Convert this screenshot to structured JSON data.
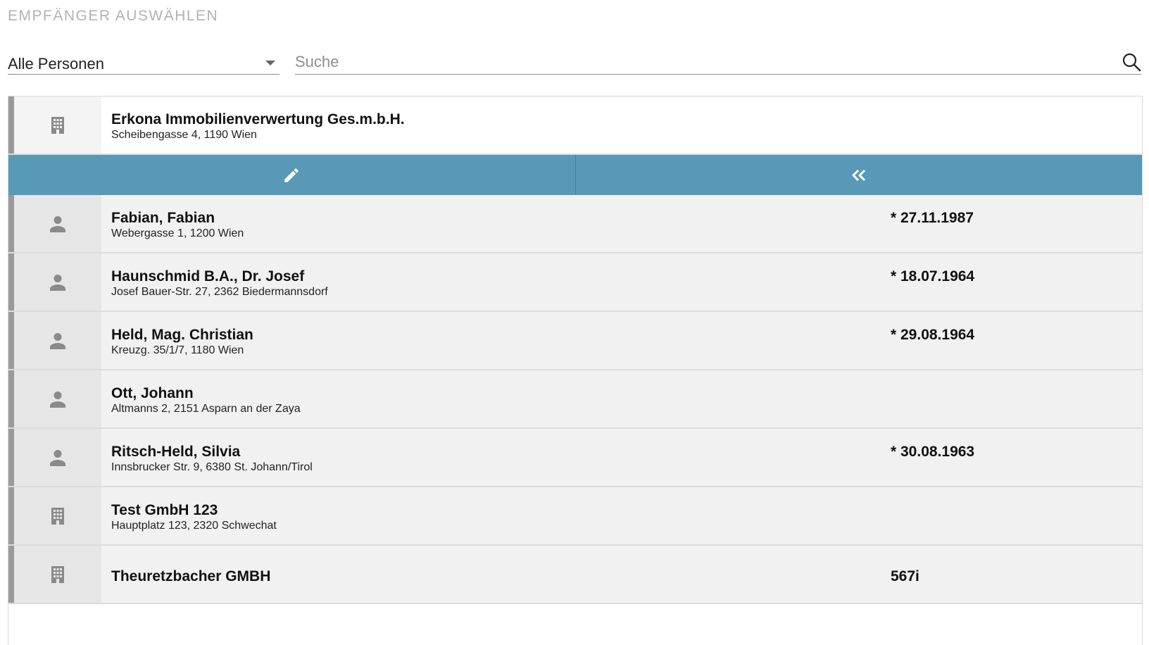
{
  "header": {
    "title": "EMPFÄNGER AUSWÄHLEN"
  },
  "filter": {
    "selected": "Alle Personen"
  },
  "search": {
    "placeholder": "Suche",
    "value": ""
  },
  "colors": {
    "action_bar": "#5799b7",
    "stripe": "#9a9a9a",
    "icon": "#8a8a8a"
  },
  "selected_entry": {
    "icon": "building-icon",
    "name": "Erkona Immobilienverwertung Ges.m.b.H.",
    "address": "Scheibengasse 4, 1190 Wien"
  },
  "actions": [
    {
      "icon": "pencil-icon"
    },
    {
      "icon": "double-chevron-left-icon"
    }
  ],
  "entries": [
    {
      "icon": "person-icon",
      "name": "Fabian, Fabian",
      "address": "Webergasse 1, 1200 Wien",
      "extra": "* 27.11.1987"
    },
    {
      "icon": "person-icon",
      "name": "Haunschmid B.A., Dr. Josef",
      "address": "Josef Bauer-Str. 27, 2362 Biedermannsdorf",
      "extra": "* 18.07.1964"
    },
    {
      "icon": "person-icon",
      "name": "Held, Mag. Christian",
      "address": "Kreuzg. 35/1/7, 1180 Wien",
      "extra": "* 29.08.1964"
    },
    {
      "icon": "person-icon",
      "name": "Ott, Johann",
      "address": "Altmanns 2, 2151 Asparn an der Zaya",
      "extra": ""
    },
    {
      "icon": "person-icon",
      "name": "Ritsch-Held, Silvia",
      "address": "Innsbrucker Str. 9, 6380 St. Johann/Tirol",
      "extra": "* 30.08.1963"
    },
    {
      "icon": "building-icon",
      "name": "Test GmbH 123",
      "address": "Hauptplatz 123, 2320 Schwechat",
      "extra": ""
    },
    {
      "icon": "building-icon",
      "name": "Theuretzbacher GMBH",
      "address": "",
      "extra": "567i"
    }
  ]
}
